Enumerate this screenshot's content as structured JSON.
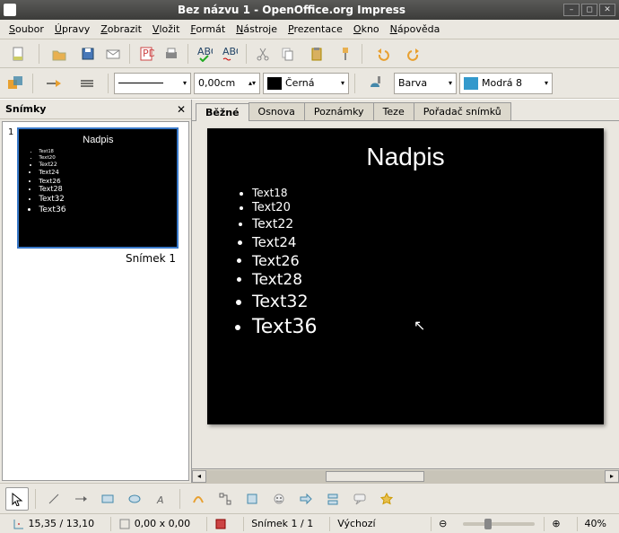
{
  "window": {
    "title": "Bez názvu 1 - OpenOffice.org Impress"
  },
  "menu": {
    "file": "Soubor",
    "edit": "Úpravy",
    "view": "Zobrazit",
    "insert": "Vložit",
    "format": "Formát",
    "tools": "Nástroje",
    "presentation": "Prezentace",
    "window": "Okno",
    "help": "Nápověda"
  },
  "format_toolbar": {
    "line_style_label": "",
    "line_width": "0,00cm",
    "line_color": "Černá",
    "fill_type": "Barva",
    "fill_color": "Modrá 8"
  },
  "colors": {
    "line": "#000000",
    "fill": "#3399cc"
  },
  "slides_panel": {
    "title": "Snímky",
    "items": [
      {
        "num": "1",
        "title": "Nadpis",
        "bullets": [
          "Text18",
          "Text20",
          "Text22",
          "Text24",
          "Text26",
          "Text28",
          "Text32",
          "Text36"
        ],
        "label": "Snímek 1"
      }
    ]
  },
  "tabs": {
    "normal": "Běžné",
    "outline": "Osnova",
    "notes": "Poznámky",
    "theses": "Teze",
    "sorter": "Pořadač snímků"
  },
  "slide": {
    "title": "Nadpis",
    "bullets": [
      {
        "text": "Text18",
        "size": 12
      },
      {
        "text": "Text20",
        "size": 13
      },
      {
        "text": "Text22",
        "size": 14
      },
      {
        "text": "Text24",
        "size": 15
      },
      {
        "text": "Text26",
        "size": 16
      },
      {
        "text": "Text28",
        "size": 17
      },
      {
        "text": "Text32",
        "size": 19
      },
      {
        "text": "Text36",
        "size": 22
      }
    ]
  },
  "status": {
    "pos": "15,35 / 13,10",
    "size": "0,00 x 0,00",
    "slide": "Snímek 1 / 1",
    "layout": "Výchozí",
    "zoom": "40%"
  }
}
